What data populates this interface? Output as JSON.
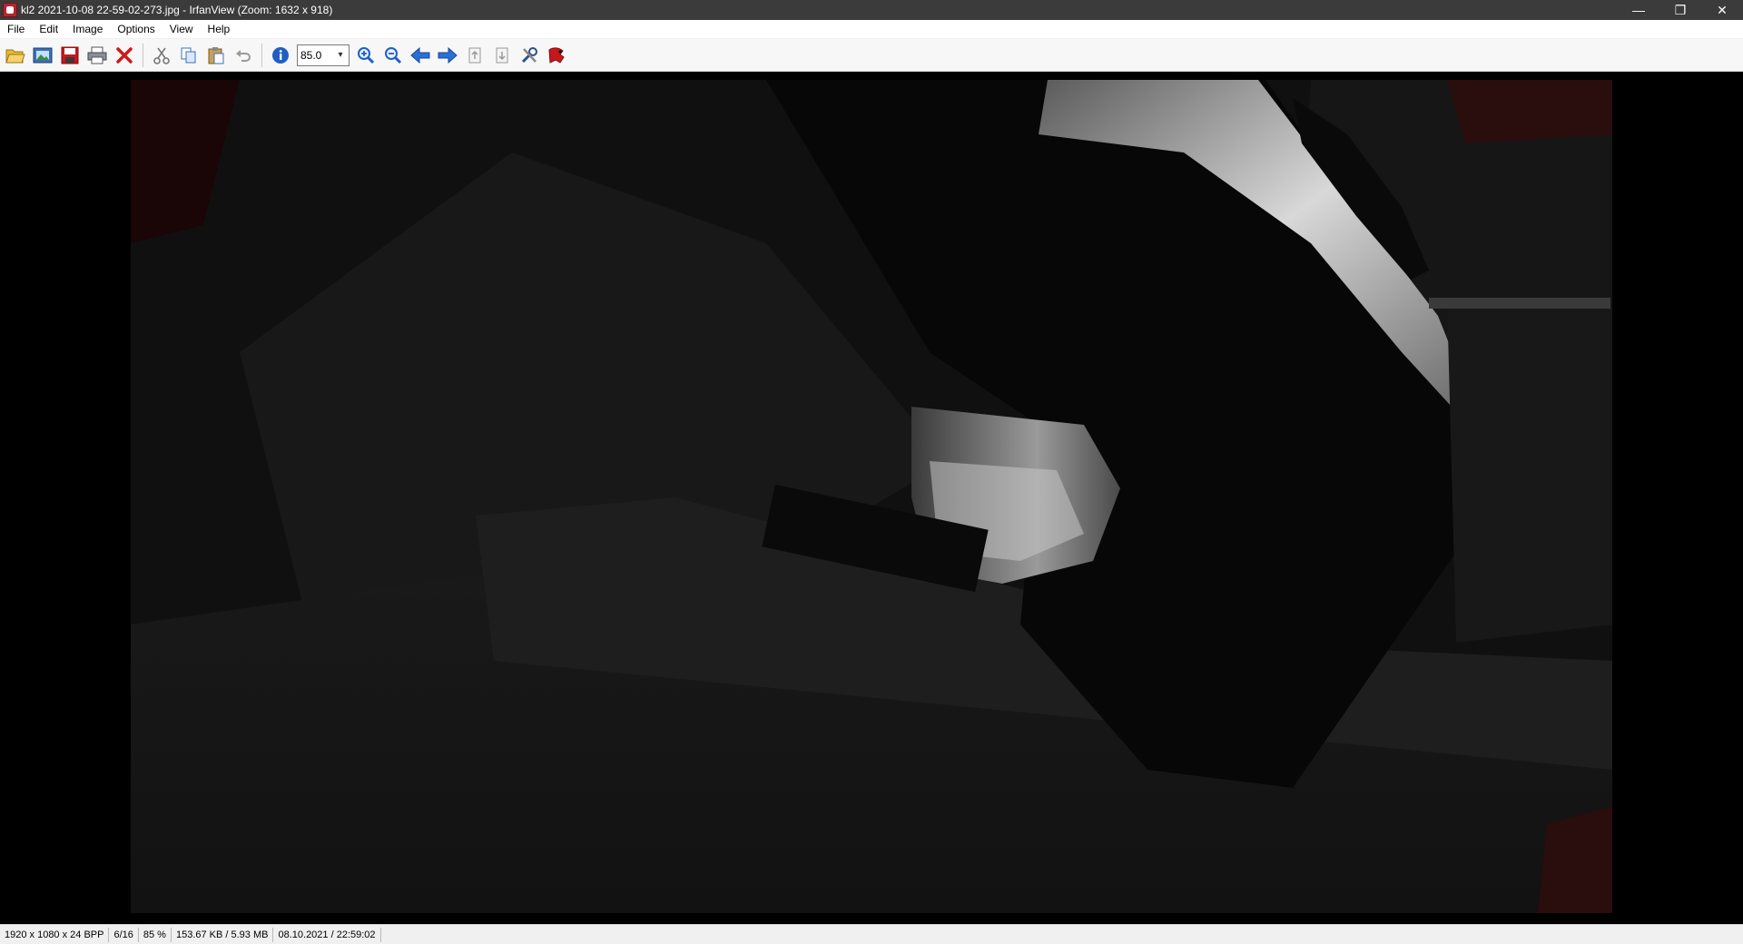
{
  "window": {
    "title": "kl2 2021-10-08 22-59-02-273.jpg - IrfanView (Zoom: 1632 x 918)",
    "controls": {
      "minimize": "—",
      "restore": "❐",
      "close": "✕"
    }
  },
  "menu": {
    "items": [
      {
        "label": "File"
      },
      {
        "label": "Edit"
      },
      {
        "label": "Image"
      },
      {
        "label": "Options"
      },
      {
        "label": "View"
      },
      {
        "label": "Help"
      }
    ]
  },
  "toolbar": {
    "zoom_value": "85.0",
    "buttons": [
      "open-folder-icon",
      "slideshow-icon",
      "save-icon",
      "print-icon",
      "delete-icon",
      "cut-icon",
      "copy-icon",
      "paste-icon",
      "undo-icon",
      "info-icon",
      "zoom-in-icon",
      "zoom-out-icon",
      "previous-arrow-icon",
      "next-arrow-icon",
      "first-page-icon",
      "last-page-icon",
      "settings-icon",
      "exit-icon"
    ]
  },
  "status": {
    "dimensions": "1920 x 1080 x 24 BPP",
    "position": "6/16",
    "zoom": "85 %",
    "size": "153.67 KB / 5.93 MB",
    "datetime": "08.10.2021 / 22:59:02"
  },
  "colors": {
    "titlebar_bg": "#3b3b3b",
    "viewport_bg": "#000000",
    "accent_red": "#c8161d",
    "accent_blue": "#2a6fd6"
  }
}
